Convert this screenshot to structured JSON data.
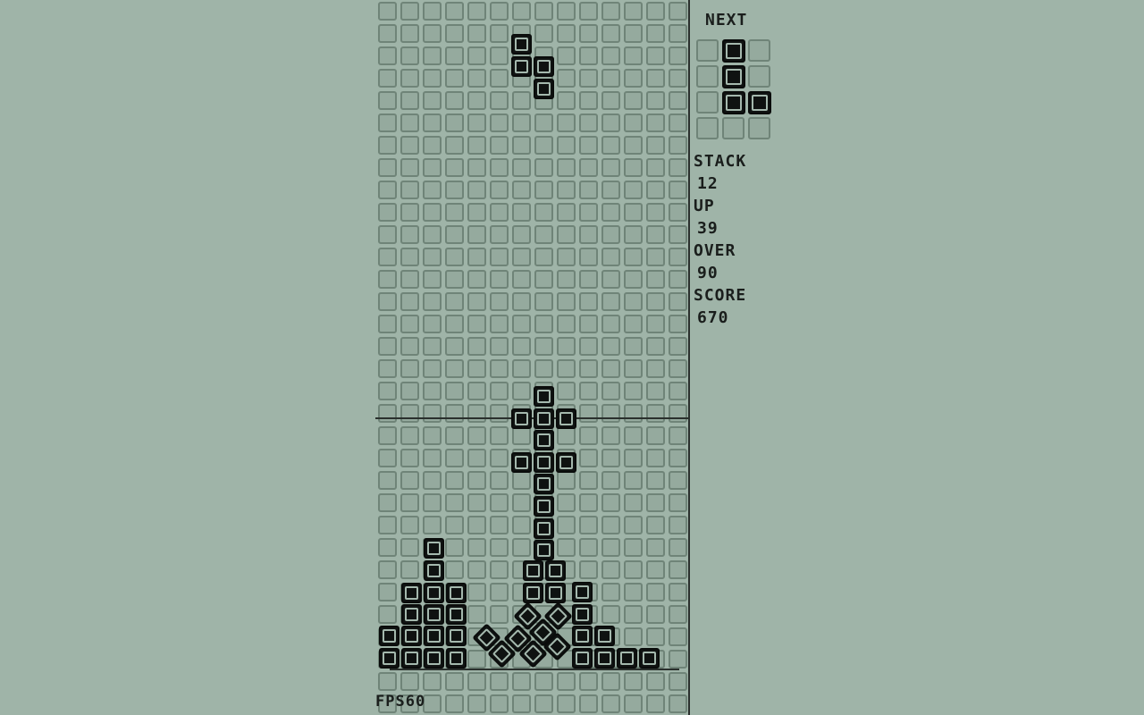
{
  "colors": {
    "background": "#9fb4a8",
    "block": "#101312",
    "cell_border": "#6f8478",
    "text": "#1a1e1c"
  },
  "next_label": "NEXT",
  "stats": {
    "stack_label": "STACK",
    "stack_value": "12",
    "up_label": "UP",
    "up_value": "39",
    "over_label": "OVER",
    "over_value": "90",
    "score_label": "SCORE",
    "score_value": "670"
  },
  "fps_text": "FPS60"
}
